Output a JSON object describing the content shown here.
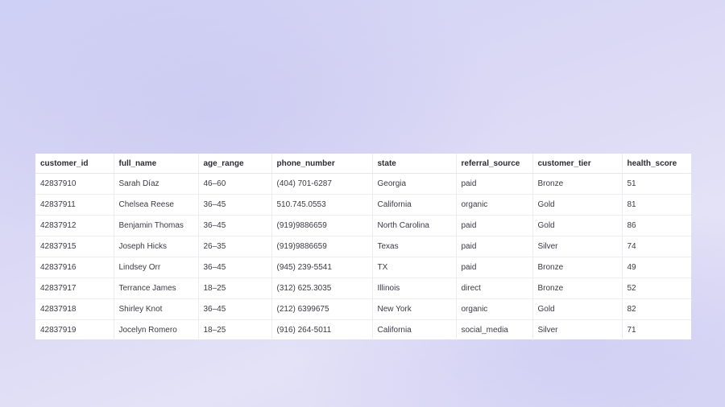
{
  "table": {
    "columns": [
      "customer_id",
      "full_name",
      "age_range",
      "phone_number",
      "state",
      "referral_source",
      "customer_tier",
      "health_score"
    ],
    "rows": [
      [
        "42837910",
        "Sarah Díaz",
        "46–60",
        "(404) 701-6287",
        "Georgia",
        "paid",
        "Bronze",
        "51"
      ],
      [
        "42837911",
        "Chelsea Reese",
        "36–45",
        "510.745.0553",
        "California",
        "organic",
        "Gold",
        "81"
      ],
      [
        "42837912",
        "Benjamin Thomas",
        "36–45",
        "(919)9886659",
        "North Carolina",
        "paid",
        "Gold",
        "86"
      ],
      [
        "42837915",
        "Joseph Hicks",
        "26–35",
        "(919)9886659",
        "Texas",
        "paid",
        "Silver",
        "74"
      ],
      [
        "42837916",
        "Lindsey Orr",
        "36–45",
        "(945) 239-5541",
        "TX",
        "paid",
        "Bronze",
        "49"
      ],
      [
        "42837917",
        "Terrance James",
        "18–25",
        "(312) 625.3035",
        "Illinois",
        "direct",
        "Bronze",
        "52"
      ],
      [
        "42837918",
        "Shirley Knot",
        "36–45",
        "(212) 6399675",
        "New York",
        "organic",
        "Gold",
        "82"
      ],
      [
        "42837919",
        "Jocelyn Romero",
        "18–25",
        "(916) 264-5011",
        "California",
        "social_media",
        "Silver",
        "71"
      ]
    ]
  },
  "colors": {
    "background_start": "#cfd0f5",
    "background_end": "#e4e2f6",
    "table_bg": "#ffffff",
    "grid_line": "#ececf1",
    "text": "#3a3a44"
  }
}
